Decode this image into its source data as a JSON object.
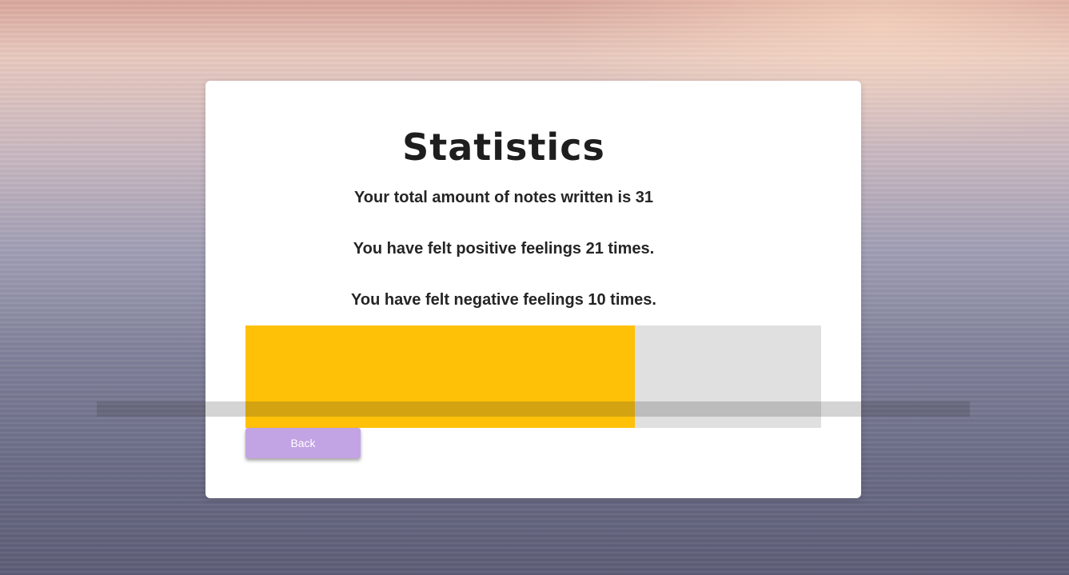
{
  "page": {
    "title": "Statistics",
    "stats": {
      "total_notes": "Your total amount of notes written is 31",
      "positive": "You have felt positive feelings 21 times.",
      "negative": "You have felt negative feelings 10 times."
    },
    "progress": {
      "positive_count": 21,
      "negative_count": 10,
      "total": 31,
      "fill_fraction": 0.677,
      "fill_color": "#ffc107",
      "track_color": "#e0e0e0"
    },
    "back_label": "Back"
  },
  "colors": {
    "card": "#ffffff",
    "button": "#c2a3e3",
    "text": "#252525"
  }
}
